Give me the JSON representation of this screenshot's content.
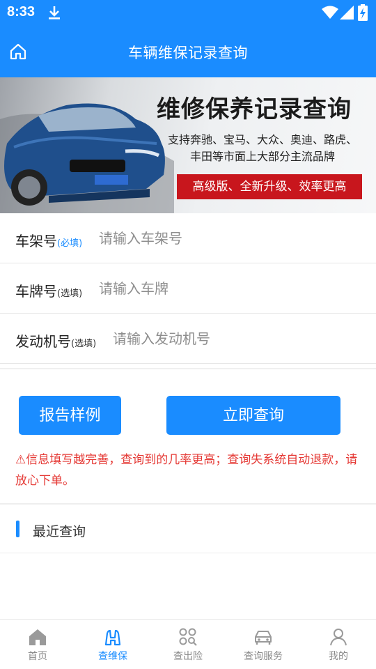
{
  "status_bar": {
    "time": "8:33"
  },
  "header": {
    "title": "车辆维保记录查询"
  },
  "banner": {
    "title": "维修保养记录查询",
    "subtitle_line1": "支持奔驰、宝马、大众、奥迪、路虎、",
    "subtitle_line2": "丰田等市面上大部分主流品牌",
    "badge": "高级版、全新升级、效率更高"
  },
  "form": {
    "vin": {
      "label": "车架号",
      "tag": "(必填)",
      "placeholder": "请输入车架号"
    },
    "plate": {
      "label": "车牌号",
      "tag": "(选填)",
      "placeholder": "请输入车牌"
    },
    "engine": {
      "label": "发动机号",
      "tag": "(选填)",
      "placeholder": "请输入发动机号"
    }
  },
  "buttons": {
    "sample": "报告样例",
    "query": "立即查询"
  },
  "notice": "⚠信息填写越完善，查询到的几率更高；查询失系统自动退款，请放心下单。",
  "recent": {
    "title": "最近查询"
  },
  "nav": {
    "items": [
      {
        "label": "首页",
        "icon": "home-icon"
      },
      {
        "label": "查维保",
        "icon": "binoculars-icon",
        "active": true
      },
      {
        "label": "查出险",
        "icon": "apps-search-icon"
      },
      {
        "label": "查询服务",
        "icon": "car-icon"
      },
      {
        "label": "我的",
        "icon": "user-icon"
      }
    ]
  },
  "colors": {
    "primary": "#1a8cff",
    "warning": "#e53935",
    "banner_red": "#c8161d"
  }
}
